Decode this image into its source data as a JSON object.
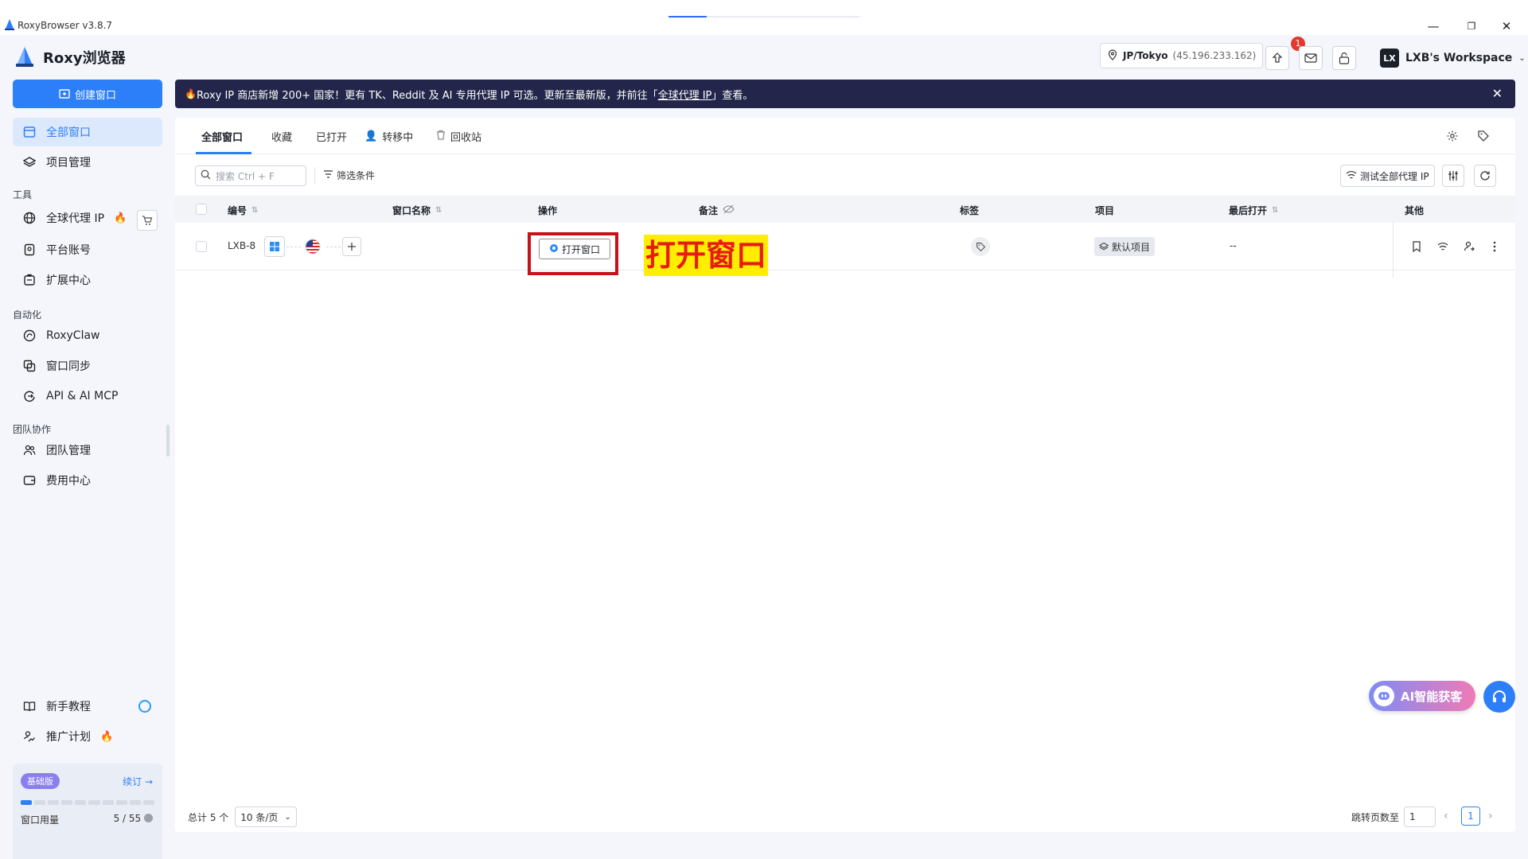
{
  "titlebar": {
    "title": "RoxyBrowser v3.8.7",
    "minimize": "—",
    "maximize": "❐",
    "close": "✕"
  },
  "brand": {
    "name": "Roxy浏览器"
  },
  "sidebar": {
    "create_label": "创建窗口",
    "items": [
      {
        "label": "全部窗口",
        "active": true
      },
      {
        "label": "项目管理"
      }
    ],
    "tools_title": "工具",
    "tools": [
      {
        "label": "全球代理 IP"
      },
      {
        "label": "平台账号"
      },
      {
        "label": "扩展中心"
      }
    ],
    "auto_title": "自动化",
    "auto": [
      {
        "label": "RoxyClaw"
      },
      {
        "label": "窗口同步"
      },
      {
        "label": "API & AI MCP"
      }
    ],
    "team_title": "团队协作",
    "team": [
      {
        "label": "团队管理"
      },
      {
        "label": "费用中心"
      }
    ],
    "bottom": [
      {
        "label": "新手教程"
      },
      {
        "label": "推广计划"
      }
    ],
    "plan": {
      "badge": "基础版",
      "renew": "续订 →",
      "usage_label": "窗口用量",
      "usage_value": "5 / 55",
      "usage_fraction": 0.09
    }
  },
  "header": {
    "location": "JP/Tokyo",
    "ip": "(45.196.233.162)",
    "notification_count": "1",
    "workspace_initials": "LX",
    "workspace_name": "LXB's Workspace"
  },
  "banner": {
    "text_before": "Roxy IP 商店新增 200+ 国家！更有 TK、Reddit 及 AI 专用代理 IP 可选。更新至最新版，并前往「",
    "link": "全球代理 IP",
    "text_after": "」查看。",
    "close": "✕"
  },
  "tabs": [
    {
      "label": "全部窗口",
      "active": true
    },
    {
      "label": "收藏"
    },
    {
      "label": "已打开"
    },
    {
      "label": "转移中"
    },
    {
      "label": "回收站"
    }
  ],
  "toolbar": {
    "search_placeholder": "搜索 Ctrl + F",
    "filter_label": "筛选条件",
    "test_ip_label": "测试全部代理 IP"
  },
  "table": {
    "headers": {
      "id": "编号",
      "name": "窗口名称",
      "action": "操作",
      "note": "备注",
      "tags": "标签",
      "project": "项目",
      "last_open": "最后打开",
      "other": "其他"
    },
    "rows": [
      {
        "id": "LXB-8",
        "action_label": "打开窗口",
        "project": "默认项目",
        "last_open": "--"
      }
    ]
  },
  "callout": {
    "text": "打开窗口",
    "color": "#e81b12",
    "background": "#ffee00"
  },
  "footer": {
    "total": "总计 5 个",
    "page_size": "10 条/页",
    "jump_label": "跳转页数至",
    "jump_value": "1",
    "current_page": "1"
  },
  "floating": {
    "ai_label": "AI智能获客"
  },
  "colors": {
    "accent": "#2d7ff9",
    "banner_bg": "#23264a",
    "highlight_frame": "#c8121a"
  }
}
